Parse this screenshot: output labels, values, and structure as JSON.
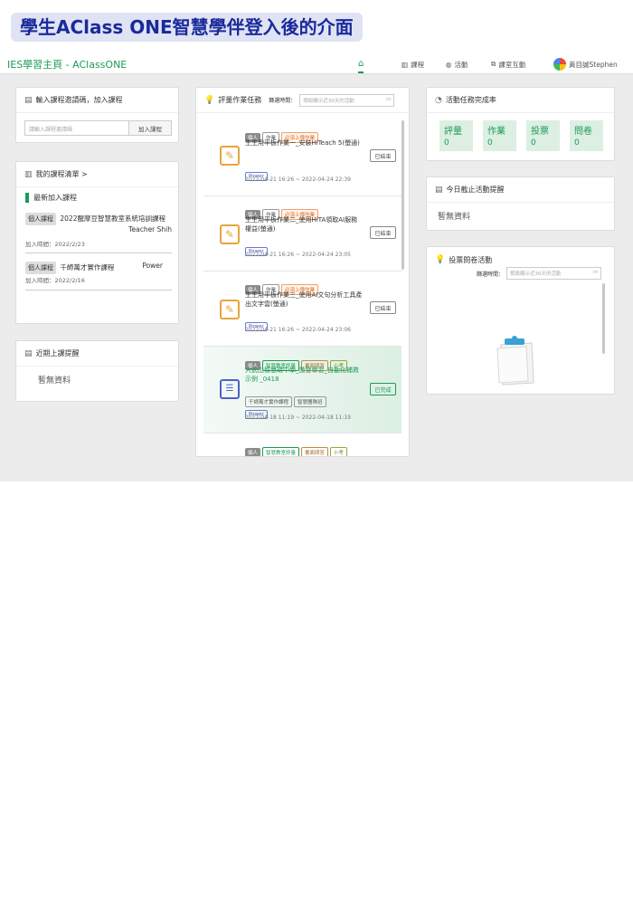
{
  "caption": "學生AClass  ONE智慧學伴登入後的介面",
  "app": {
    "brand": "IES學習主頁 - AClassONE",
    "nav": [
      {
        "icon": "home-icon",
        "label": ""
      },
      {
        "icon": "course-icon",
        "label": "課程"
      },
      {
        "icon": "activity-icon",
        "label": "活動"
      },
      {
        "icon": "classroom-icon",
        "label": "課室互動"
      }
    ],
    "user": "黃目誠Stephen"
  },
  "join": {
    "title": "輸入課程邀請碼，加入課程",
    "placeholder": "請輸入課程邀請碼",
    "button": "加入課程"
  },
  "courses": {
    "title": "我的課程清單 >",
    "section": "最新加入課程",
    "items": [
      {
        "badge": "個人課程",
        "name": "2022醒摩豆智慧教室系統培訓課程",
        "teacher": "Teacher Shih",
        "joined": "加入時間：2022/2/23"
      },
      {
        "badge": "個人課程",
        "name": "千師萬才實作課程",
        "teacher": "Power",
        "joined": "加入時間：2022/2/16"
      }
    ]
  },
  "upcoming": {
    "title": "近期上課提醒",
    "empty": "暫無資料"
  },
  "tasks": {
    "title": "評量作業任務",
    "filter_label": "篩選時間：",
    "filter_placeholder": "預設顯示近30天的活動",
    "items": [
      {
        "tags": [
          "個人",
          "作業",
          "必須上傳作業"
        ],
        "title": "生生用平板作業一_安裝HiTeach 5(螢通)",
        "owner": "Power",
        "date": "2022-04-21 16:26 ~ 2022-04-24 22:39",
        "state": "已結束",
        "icon": "homework-icon"
      },
      {
        "tags": [
          "個人",
          "作業",
          "必須上傳作業"
        ],
        "title": "生生用平板作業二_使用HiTA領取AI服務權益(螢通)",
        "owner": "Power",
        "date": "2022-04-21 16:26 ~ 2022-04-24 23:05",
        "state": "已結束",
        "icon": "homework-icon"
      },
      {
        "tags": [
          "個人",
          "作業",
          "必須上傳作業"
        ],
        "title": "生生用平板作業三_使用AI文句分析工具產出文字雲(螢通)",
        "owner": "Power",
        "date": "2022-04-21 16:26 ~ 2022-04-24 23:06",
        "state": "已結束",
        "icon": "homework-icon"
      },
      {
        "tags": [
          "個人",
          "智慧教室評量",
          "書面問答",
          "小考"
        ],
        "title": "大武山智慧環中學_激發學習_自動化補救示例 _0418",
        "extra": "千師萬才實作課程",
        "extra2": "智慧團隊班",
        "owner": "Power",
        "date": "2022-04-18 11:19 ~ 2022-04-18 11:19",
        "state": "已完成",
        "icon": "quiz-icon"
      },
      {
        "tags": [
          "個人",
          "智慧教室評量",
          "書面問答",
          "小考"
        ]
      }
    ]
  },
  "completion": {
    "title": "活動任務完成率",
    "stats": [
      {
        "label": "評量",
        "value": "0"
      },
      {
        "label": "作業",
        "value": "0"
      },
      {
        "label": "投票",
        "value": "0"
      },
      {
        "label": "問卷",
        "value": "0"
      }
    ]
  },
  "today": {
    "title": "今日截止活動提醒",
    "empty": "暫無資料"
  },
  "vote": {
    "title": "投票問卷活動",
    "filter_label": "篩選時間：",
    "filter_placeholder": "預設顯示近30天的活動"
  }
}
